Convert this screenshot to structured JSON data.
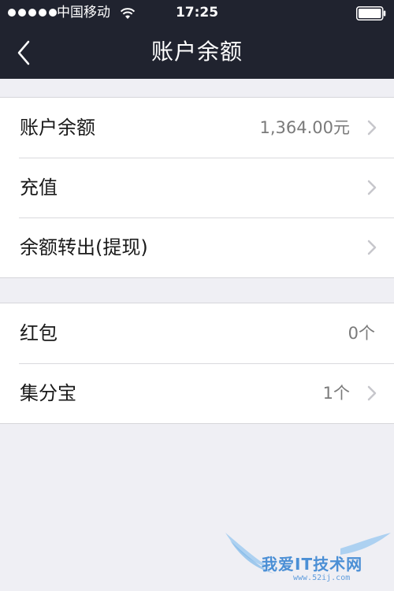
{
  "status_bar": {
    "carrier": "中国移动",
    "time": "17:25"
  },
  "nav": {
    "title": "账户余额"
  },
  "group1": [
    {
      "label": "账户余额",
      "value": "1,364.00元",
      "has_chevron": true
    },
    {
      "label": "充值",
      "value": "",
      "has_chevron": true
    },
    {
      "label": "余额转出(提现)",
      "value": "",
      "has_chevron": true
    }
  ],
  "group2": [
    {
      "label": "红包",
      "value": "0个",
      "has_chevron": false
    },
    {
      "label": "集分宝",
      "value": "1个",
      "has_chevron": true
    }
  ],
  "watermark": {
    "text": "我爱IT技术网",
    "sub": "www.52ij.com"
  },
  "colors": {
    "nav_background": "#20232f",
    "page_background": "#efeff4",
    "row_background": "#ffffff",
    "value_text": "#7a7a7a",
    "chevron": "#c7c7cc"
  },
  "icons": {
    "back": "chevron-left-icon",
    "row_arrow": "chevron-right-icon",
    "wifi": "wifi-icon",
    "battery": "battery-icon"
  }
}
